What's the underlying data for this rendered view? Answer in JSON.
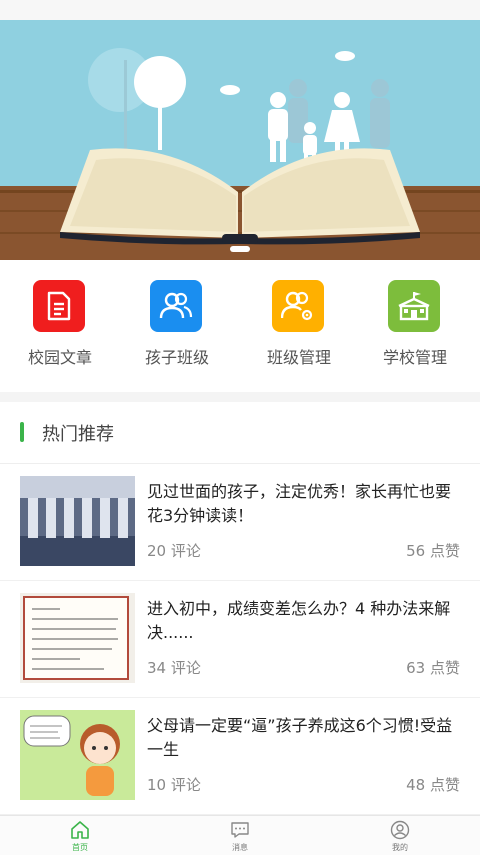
{
  "quick_nav": [
    {
      "label": "校园文章",
      "icon": "document-icon",
      "color": "#f01e1e"
    },
    {
      "label": "孩子班级",
      "icon": "users-icon",
      "color": "#1a8ef0"
    },
    {
      "label": "班级管理",
      "icon": "users-gear-icon",
      "color": "#ffb000"
    },
    {
      "label": "学校管理",
      "icon": "school-icon",
      "color": "#7dbd3c"
    }
  ],
  "hot": {
    "title": "热门推荐",
    "accent": "#3bb44a"
  },
  "articles": [
    {
      "title": "见过世面的孩子，注定优秀！家长再忙也要花3分钟读读！",
      "comments": "20 评论",
      "likes": "56 点赞"
    },
    {
      "title": "进入初中，成绩变差怎么办？4 种办法来解决......",
      "comments": "34 评论",
      "likes": "63 点赞"
    },
    {
      "title": "父母请一定要“逼”孩子养成这6个习惯!受益一生",
      "comments": "10 评论",
      "likes": "48 点赞"
    }
  ],
  "tabbar": {
    "home": "首页",
    "messages": "消息",
    "mine": "我的",
    "active_color": "#3bb44a"
  }
}
